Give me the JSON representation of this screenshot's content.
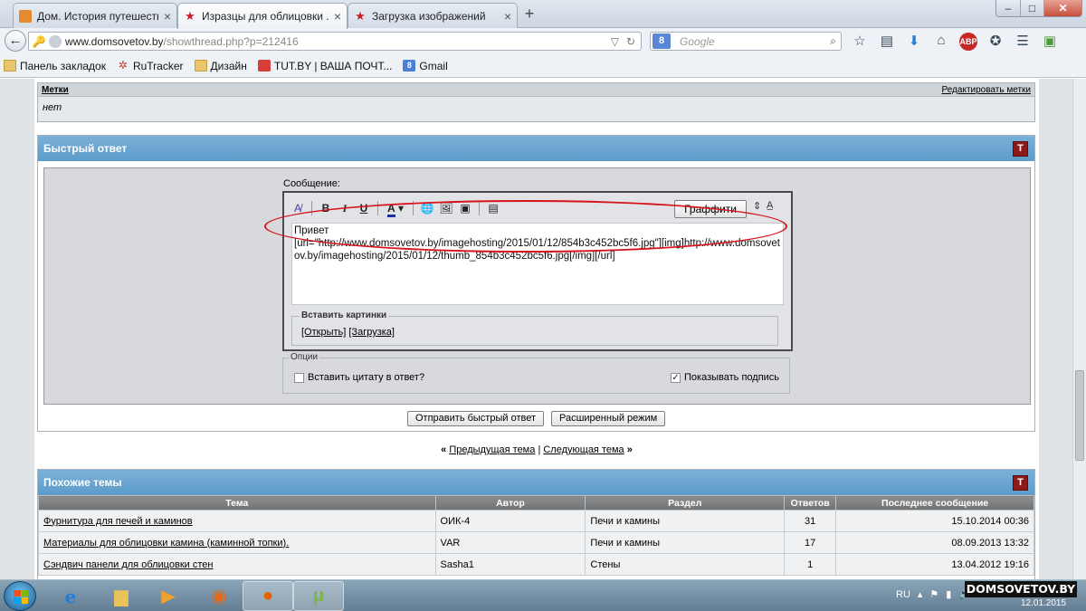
{
  "browser": {
    "tabs": [
      {
        "title": "Дом. История путешеств..."
      },
      {
        "title": "Изразцы для облицовки ..."
      },
      {
        "title": "Загрузка изображений"
      }
    ],
    "url_host": "www.domsovetov.by",
    "url_path": "/showthread.php?p=212416",
    "search_placeholder": "Google",
    "search_engine_letter": "8",
    "adblock_label": "ABP"
  },
  "bookmarks": [
    {
      "label": "Панель закладок",
      "icon": "folder-icon"
    },
    {
      "label": "RuTracker",
      "icon": "rutracker-icon"
    },
    {
      "label": "Дизайн",
      "icon": "folder-icon"
    },
    {
      "label": "TUT.BY | ВАША ПОЧТ...",
      "icon": "mail-icon"
    },
    {
      "label": "Gmail",
      "icon": "gmail-icon"
    }
  ],
  "tags": {
    "title": "Метки",
    "edit_link": "Редактировать метки",
    "value": "нет"
  },
  "quick_reply": {
    "title": "Быстрый ответ",
    "message_label": "Сообщение:",
    "graffiti_button": "Граффити",
    "message_text": "Привет\n[url=\"http://www.domsovetov.by/imagehosting/2015/01/12/854b3c452bc5f6.jpg\"][img]http://www.domsovetov.by/imagehosting/2015/01/12/thumb_854b3c452bc5f6.jpg[/img][/url]",
    "insert_pictures_legend": "Вставить картинки",
    "open_link": "[Открыть]",
    "upload_link": "[Загрузка]",
    "options_legend": "Опции",
    "quote_option": "Вставить цитату в ответ?",
    "quote_checked": false,
    "signature_option": "Показывать подпись",
    "signature_checked": true,
    "submit_button": "Отправить быстрый ответ",
    "advanced_button": "Расширенный режим"
  },
  "thread_nav": {
    "prev": "Предыдущая тема",
    "next": "Следующая тема",
    "sep": "|"
  },
  "similar": {
    "title": "Похожие темы",
    "columns": [
      "Тема",
      "Автор",
      "Раздел",
      "Ответов",
      "Последнее сообщение"
    ],
    "rows": [
      {
        "topic": "Фурнитура для печей и каминов",
        "author": "ОИК-4",
        "section": "Печи и камины",
        "replies": "31",
        "last": "15.10.2014 00:36"
      },
      {
        "topic": "Материалы для облицовки камина (каминной топки).",
        "author": "VAR",
        "section": "Печи и камины",
        "replies": "17",
        "last": "08.09.2013 13:32"
      },
      {
        "topic": "Сэндвич панели для облицовки стен",
        "author": "Sasha1",
        "section": "Стены",
        "replies": "1",
        "last": "13.04.2012 19:16"
      }
    ]
  },
  "taskbar": {
    "lang": "RU",
    "brand": "DOMSOVETOV.BY",
    "date": "12.01.2015"
  },
  "colors": {
    "panel_header": "#6aa5d1",
    "annotation": "#d7131c",
    "collapse_button": "#8e1919"
  }
}
